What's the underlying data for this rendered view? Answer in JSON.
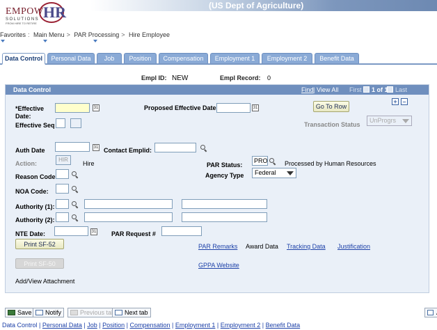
{
  "header": {
    "org_title": "(US Dept of Agriculture)",
    "logo_empow": "EMPOW",
    "logo_hr": "HR",
    "logo_sub": "SOLUTIONS",
    "logo_sub2": "FROM HIRE TO RETIRE"
  },
  "breadcrumb": {
    "items": [
      "Favorites",
      "Main Menu",
      "PAR Processing",
      "Hire Employee"
    ],
    "separators": [
      ":",
      ">",
      ">"
    ]
  },
  "tabs": [
    {
      "label": "Data Control",
      "active": true
    },
    {
      "label": "Personal Data"
    },
    {
      "label": "Job"
    },
    {
      "label": "Position"
    },
    {
      "label": "Compensation"
    },
    {
      "label": "Employment 1"
    },
    {
      "label": "Employment 2"
    },
    {
      "label": "Benefit Data"
    }
  ],
  "empl": {
    "id_label": "Empl ID:",
    "id_value": "NEW",
    "record_label": "Empl Record:",
    "record_value": "0"
  },
  "panel": {
    "title": "Data Control",
    "find": "Find",
    "view_all": "View All",
    "first": "First",
    "count": "1 of 1",
    "last": "Last",
    "plus": "+",
    "minus": "–"
  },
  "form": {
    "effective_date_label": "*Effective Date:",
    "effective_seq_label": "Effective Seq",
    "proposed_effective_date_label": "Proposed Effective Date:",
    "go_to_row": "Go To Row",
    "transaction_status_label": "Transaction Status",
    "transaction_status_value": "UnProgrs",
    "auth_date_label": "Auth Date",
    "contact_emplid_label": "Contact Emplid:",
    "action_label": "Action:",
    "action_value": "HIR",
    "action_desc": "Hire",
    "par_status_label": "PAR Status:",
    "par_status_value": "PRO",
    "par_status_desc": "Processed by Human Resources",
    "reason_code_label": "Reason Code:",
    "agency_type_label": "Agency Type",
    "agency_type_value": "Federal",
    "noa_code_label": "NOA Code:",
    "authority1_label": "Authority (1):",
    "authority2_label": "Authority (2):",
    "nte_date_label": "NTE Date:",
    "par_request_label": "PAR Request #",
    "print_sf52": "Print SF-52",
    "print_sf50": "Print SF-50",
    "par_remarks": "PAR Remarks",
    "award_data": "Award Data",
    "tracking_data": "Tracking Data",
    "justification": "Justification",
    "gppa_website": "GPPA Website",
    "add_view_attachment": "Add/View Attachment",
    "cal_glyph": "31"
  },
  "toolbar": {
    "save": "Save",
    "notify": "Notify",
    "previous_tab": "Previous tab",
    "next_tab": "Next tab",
    "right_partial": "A"
  },
  "footer_links": [
    "Data Control",
    "Personal Data",
    "Job",
    "Position",
    "Compensation",
    "Employment 1",
    "Employment 2",
    "Benefit Data"
  ]
}
